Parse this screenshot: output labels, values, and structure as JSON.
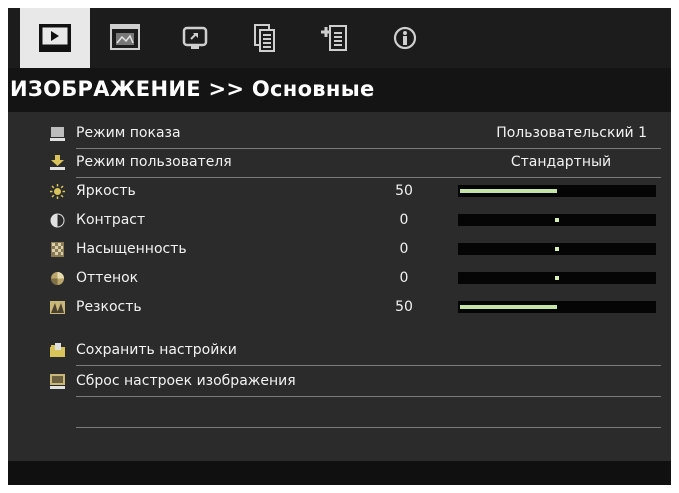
{
  "tabs": [
    {
      "icon": "image-play-icon",
      "active": true
    },
    {
      "icon": "film-display-icon",
      "active": false
    },
    {
      "icon": "monitor-setup-icon",
      "active": false
    },
    {
      "icon": "document-options-icon",
      "active": false
    },
    {
      "icon": "document-plus-icon",
      "active": false
    },
    {
      "icon": "info-settings-icon",
      "active": false
    }
  ],
  "header": {
    "title": "ИЗОБРАЖЕНИЕ >> Основные"
  },
  "menu": {
    "display_mode": {
      "label": "Режим показа",
      "value": "Пользовательский 1"
    },
    "user_mode": {
      "label": "Режим пользователя",
      "value": "Стандартный"
    },
    "brightness": {
      "label": "Яркость",
      "value": "50",
      "level": 50
    },
    "contrast": {
      "label": "Контраст",
      "value": "0",
      "level": 0
    },
    "saturation": {
      "label": "Насыщенность",
      "value": "0",
      "level": 0
    },
    "hue": {
      "label": "Оттенок",
      "value": "0",
      "level": 0
    },
    "sharpness": {
      "label": "Резкость",
      "value": "50",
      "level": 50
    },
    "save_settings": {
      "label": "Сохранить настройки"
    },
    "reset_image": {
      "label": "Сброс настроек изображения"
    }
  },
  "colors": {
    "slider_fill": "#c6e4a4",
    "background": "#2b2b2b",
    "active_tab": "#e8e8e8"
  }
}
